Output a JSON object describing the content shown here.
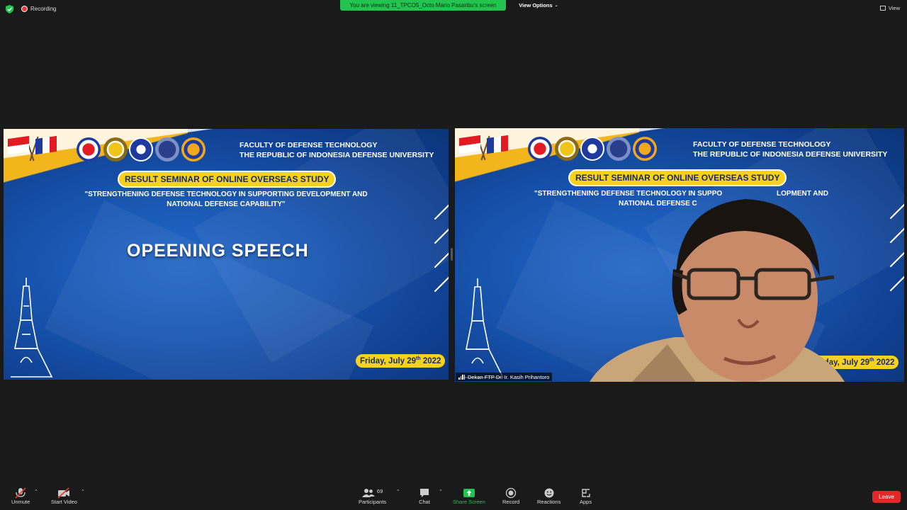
{
  "topbar": {
    "recording_label": "Recording",
    "viewing_banner": "You are viewing 11_TPCO5_Octo Mario Pasaribu's screen",
    "view_options_label": "View Options",
    "view_label": "View"
  },
  "slides": [
    {
      "faculty_line1": "FACULTY OF DEFENSE TECHNOLOGY",
      "faculty_line2": "THE REPUBLIC OF INDONESIA DEFENSE UNIVERSITY",
      "seminar_title": "RESULT SEMINAR OF ONLINE OVERSEAS STUDY",
      "theme_line1": "\"STRENGTHENING DEFENSE TECHNOLOGY IN SUPPORTING DEVELOPMENT AND",
      "theme_line2": "NATIONAL DEFENSE CAPABILITY\"",
      "heading": "OPEENING SPEECH",
      "date_prefix": "Friday, July 29",
      "date_sup": "th",
      "date_suffix": " 2022"
    },
    {
      "faculty_line1": "FACULTY OF DEFENSE TECHNOLOGY",
      "faculty_line2": "THE REPUBLIC OF INDONESIA DEFENSE UNIVERSITY",
      "seminar_title": "RESULT SEMINAR OF ONLINE OVERSEAS STUDY",
      "theme_line1": "\"STRENGTHENING DEFENSE TECHNOLOGY IN SUPPO",
      "theme_line1b": "LOPMENT AND",
      "theme_line2": "NATIONAL DEFENSE C",
      "date_prefix": "Friday, July 29",
      "date_sup": "th",
      "date_suffix": " 2022",
      "participant_name": "Dekan FTP Dr. Ir. Kasih Prihantoro"
    }
  ],
  "toolbar": {
    "unmute": "Unmute",
    "start_video": "Start Video",
    "participants": "Participants",
    "participant_count": "69",
    "chat": "Chat",
    "share_screen": "Share Screen",
    "record": "Record",
    "reactions": "Reactions",
    "apps": "Apps",
    "leave": "Leave"
  },
  "colors": {
    "share_green": "#23c350",
    "leave_red": "#e02828",
    "slide_blue": "#1957b3",
    "accent_yellow": "#f7d21c"
  }
}
